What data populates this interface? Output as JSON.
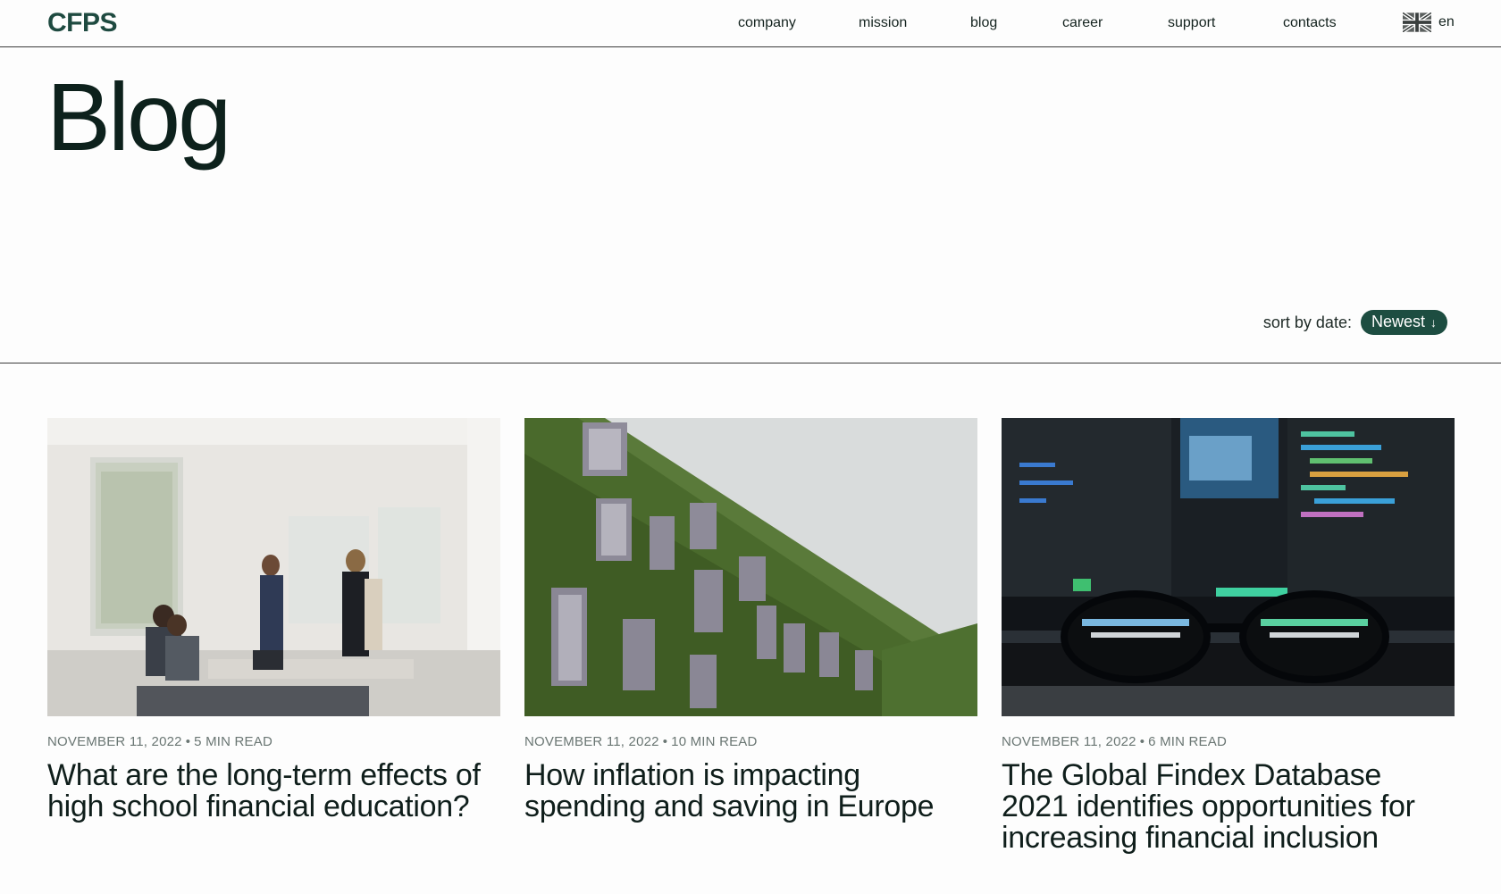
{
  "brand": {
    "logo_text": "CFPS"
  },
  "nav": {
    "items": [
      {
        "label": "company"
      },
      {
        "label": "mission"
      },
      {
        "label": "blog"
      },
      {
        "label": "career"
      },
      {
        "label": "support"
      },
      {
        "label": "contacts"
      }
    ],
    "language": {
      "label": "en",
      "flag_icon": "uk-flag-icon"
    }
  },
  "page": {
    "title": "Blog"
  },
  "sort": {
    "label": "sort by date:",
    "value": "Newest",
    "arrow": "↓"
  },
  "posts": [
    {
      "date": "NOVEMBER 11, 2022",
      "read_time": "5 MIN READ",
      "title": "What are the long-term effects of high school financial education?"
    },
    {
      "date": "NOVEMBER 11, 2022",
      "read_time": "10 MIN READ",
      "title": "How inflation is impacting spending and saving in Europe"
    },
    {
      "date": "NOVEMBER 11, 2022",
      "read_time": "6 MIN READ",
      "title": "The Global Findex Database 2021 identifies opportunities for increasing financial inclusion"
    }
  ],
  "colors": {
    "brand": "#1e4a40",
    "pill_bg": "#1d4d41",
    "text": "#0f1e1b",
    "meta": "#6a7673"
  }
}
